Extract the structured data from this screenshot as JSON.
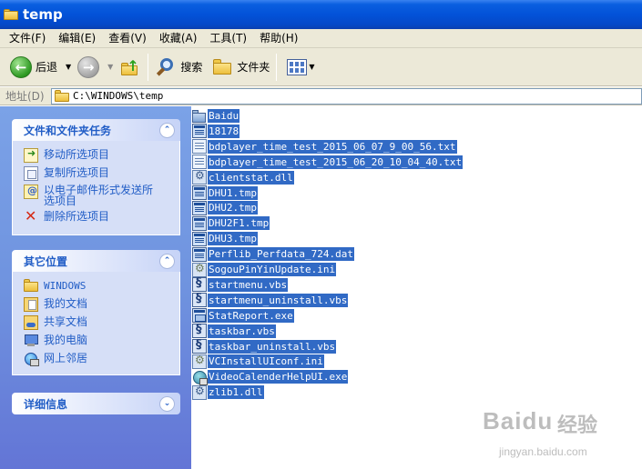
{
  "window": {
    "title": "temp"
  },
  "menubar": {
    "items": [
      "文件(F)",
      "编辑(E)",
      "查看(V)",
      "收藏(A)",
      "工具(T)",
      "帮助(H)"
    ]
  },
  "toolbar": {
    "back_label": "后退",
    "search_label": "搜索",
    "folders_label": "文件夹"
  },
  "address": {
    "label": "地址(D)",
    "path": "C:\\WINDOWS\\temp"
  },
  "taskpane": {
    "file_tasks": {
      "title": "文件和文件夹任务",
      "items": [
        "移动所选项目",
        "复制所选项目",
        "以电子邮件形式发送所选项目",
        "删除所选项目"
      ]
    },
    "other_places": {
      "title": "其它位置",
      "items": [
        "WINDOWS",
        "我的文档",
        "共享文档",
        "我的电脑",
        "网上邻居"
      ]
    },
    "details": {
      "title": "详细信息"
    }
  },
  "files": [
    {
      "name": "Baidu",
      "icon": "folder-icon"
    },
    {
      "name": "18178",
      "icon": "tmp-file-icon"
    },
    {
      "name": "bdplayer_time_test_2015_06_07_9_00_56.txt",
      "icon": "text-file-icon"
    },
    {
      "name": "bdplayer_time_test_2015_06_20_10_04_40.txt",
      "icon": "text-file-icon"
    },
    {
      "name": "clientstat.dll",
      "icon": "dll-file-icon"
    },
    {
      "name": "DHU1.tmp",
      "icon": "tmp-file-icon"
    },
    {
      "name": "DHU2.tmp",
      "icon": "tmp-file-icon"
    },
    {
      "name": "DHU2F1.tmp",
      "icon": "tmp-file-icon"
    },
    {
      "name": "DHU3.tmp",
      "icon": "tmp-file-icon"
    },
    {
      "name": "Perflib_Perfdata_724.dat",
      "icon": "tmp-file-icon"
    },
    {
      "name": "SogouPinYinUpdate.ini",
      "icon": "ini-file-icon"
    },
    {
      "name": "startmenu.vbs",
      "icon": "vbs-file-icon"
    },
    {
      "name": "startmenu_uninstall.vbs",
      "icon": "vbs-file-icon"
    },
    {
      "name": "StatReport.exe",
      "icon": "exe-file-icon"
    },
    {
      "name": "taskbar.vbs",
      "icon": "vbs-file-icon"
    },
    {
      "name": "taskbar_uninstall.vbs",
      "icon": "vbs-file-icon"
    },
    {
      "name": "VCInstallUIconf.ini",
      "icon": "ini-file-icon"
    },
    {
      "name": "VideoCalenderHelpUI.exe",
      "icon": "globe-exe-icon"
    },
    {
      "name": "zlib1.dll",
      "icon": "dll-file-icon"
    }
  ],
  "selection": {
    "highlight_color": "#316ac5"
  },
  "watermark": {
    "logo": "Baidu",
    "suffix": "经验",
    "url": "jingyan.baidu.com"
  }
}
